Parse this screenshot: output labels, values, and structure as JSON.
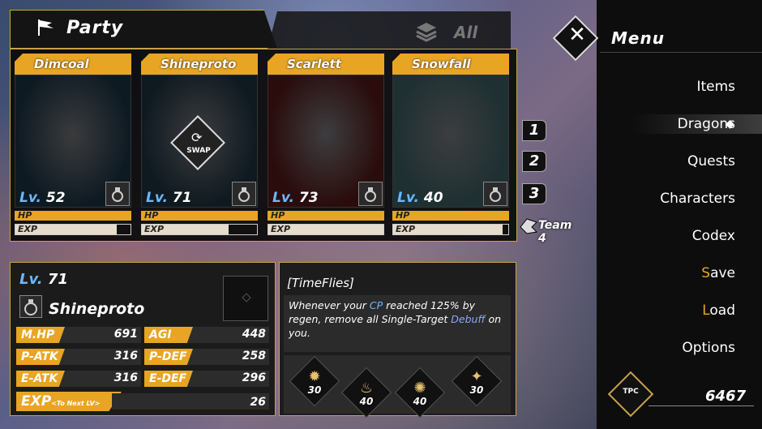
{
  "header": {
    "title": "Party",
    "all_label": "All"
  },
  "cards": [
    {
      "name": "Dimcoal",
      "lv_prefix": "Lv.",
      "level": "52",
      "hp_label": "HP",
      "exp_label": "EXP",
      "exp_fraction": 0.88,
      "art_color": "#0e1a22"
    },
    {
      "name": "Shineproto",
      "lv_prefix": "Lv.",
      "level": "71",
      "hp_label": "HP",
      "exp_label": "EXP",
      "exp_fraction": 0.75,
      "art_color": "#0f1a20",
      "swap_label": "SWAP"
    },
    {
      "name": "Scarlett",
      "lv_prefix": "Lv.",
      "level": "73",
      "hp_label": "HP",
      "exp_label": "EXP",
      "exp_fraction": 1.0,
      "art_color": "#2a0c0c"
    },
    {
      "name": "Snowfall",
      "lv_prefix": "Lv.",
      "level": "40",
      "hp_label": "HP",
      "exp_label": "EXP",
      "exp_fraction": 0.95,
      "art_color": "#1e3032"
    }
  ],
  "teams": [
    "1",
    "2",
    "3"
  ],
  "team4_label": "Team 4",
  "detail": {
    "lv_prefix": "Lv.",
    "level": "71",
    "name": "Shineproto",
    "stats": [
      {
        "label": "M.HP",
        "value": "691"
      },
      {
        "label": "AGI",
        "value": "448"
      },
      {
        "label": "P-ATK",
        "value": "316"
      },
      {
        "label": "P-DEF",
        "value": "258"
      },
      {
        "label": "E-ATK",
        "value": "316"
      },
      {
        "label": "E-DEF",
        "value": "296"
      }
    ],
    "exp_label": "EXP",
    "exp_sub": "<To Next LV>",
    "exp_value": "26"
  },
  "skill": {
    "title": "[TimeFlies]",
    "desc_1": "Whenever your ",
    "desc_cp": "CP",
    "desc_2": " reached 125% by regen, remove all Single-Target ",
    "desc_debuff": "Debuff",
    "desc_3": " on you.",
    "icons": [
      {
        "icon": "burst-icon",
        "glyph": "✹",
        "cost": "30"
      },
      {
        "icon": "flame-icon",
        "glyph": "♨",
        "cost": "40"
      },
      {
        "icon": "orbit-icon",
        "glyph": "✺",
        "cost": "40"
      },
      {
        "icon": "crystal-icon",
        "glyph": "✦",
        "cost": "30"
      }
    ]
  },
  "menu": {
    "title": "Menu",
    "items": [
      "Items",
      "Dragons",
      "Quests",
      "Characters",
      "Codex",
      "Save",
      "Load",
      "Options"
    ],
    "selected": "Dragons",
    "currency_label": "TPC",
    "currency_value": "6467"
  },
  "colors": {
    "accent": "#e8a523",
    "level_blue": "#6ab8ff",
    "menu_bg": "#0d0d0d"
  }
}
